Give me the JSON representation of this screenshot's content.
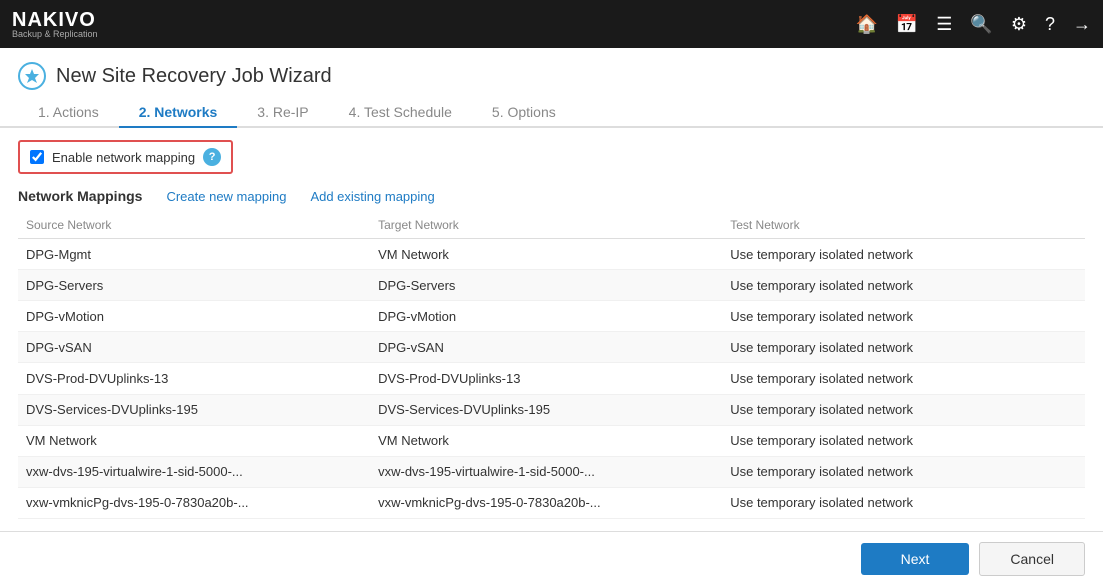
{
  "topbar": {
    "logo_nakivo": "NAKIVO",
    "logo_subtitle": "Backup & Replication"
  },
  "wizard": {
    "title": "New Site Recovery Job Wizard",
    "icon": "⚙"
  },
  "tabs": [
    {
      "id": "actions",
      "label": "1. Actions",
      "active": false
    },
    {
      "id": "networks",
      "label": "2. Networks",
      "active": true
    },
    {
      "id": "reip",
      "label": "3. Re-IP",
      "active": false
    },
    {
      "id": "test-schedule",
      "label": "4. Test Schedule",
      "active": false
    },
    {
      "id": "options",
      "label": "5. Options",
      "active": false
    }
  ],
  "enable_mapping": {
    "label": "Enable network mapping",
    "checked": true
  },
  "network_mappings": {
    "section_title": "Network Mappings",
    "create_label": "Create new mapping",
    "add_label": "Add existing mapping"
  },
  "table": {
    "headers": [
      "Source Network",
      "Target Network",
      "Test Network"
    ],
    "rows": [
      {
        "source": "DPG-Mgmt",
        "target": "VM Network",
        "test": "Use temporary isolated network"
      },
      {
        "source": "DPG-Servers",
        "target": "DPG-Servers",
        "test": "Use temporary isolated network"
      },
      {
        "source": "DPG-vMotion",
        "target": "DPG-vMotion",
        "test": "Use temporary isolated network"
      },
      {
        "source": "DPG-vSAN",
        "target": "DPG-vSAN",
        "test": "Use temporary isolated network"
      },
      {
        "source": "DVS-Prod-DVUplinks-13",
        "target": "DVS-Prod-DVUplinks-13",
        "test": "Use temporary isolated network"
      },
      {
        "source": "DVS-Services-DVUplinks-195",
        "target": "DVS-Services-DVUplinks-195",
        "test": "Use temporary isolated network"
      },
      {
        "source": "VM Network",
        "target": "VM Network",
        "test": "Use temporary isolated network"
      },
      {
        "source": "vxw-dvs-195-virtualwire-1-sid-5000-...",
        "target": "vxw-dvs-195-virtualwire-1-sid-5000-...",
        "test": "Use temporary isolated network"
      },
      {
        "source": "vxw-vmknicPg-dvs-195-0-7830a20b-...",
        "target": "vxw-vmknicPg-dvs-195-0-7830a20b-...",
        "test": "Use temporary isolated network"
      }
    ]
  },
  "footer": {
    "next_label": "Next",
    "cancel_label": "Cancel"
  },
  "topbar_icons": [
    "🏠",
    "📅",
    "☰",
    "🔍",
    "⚙",
    "?",
    "→"
  ]
}
